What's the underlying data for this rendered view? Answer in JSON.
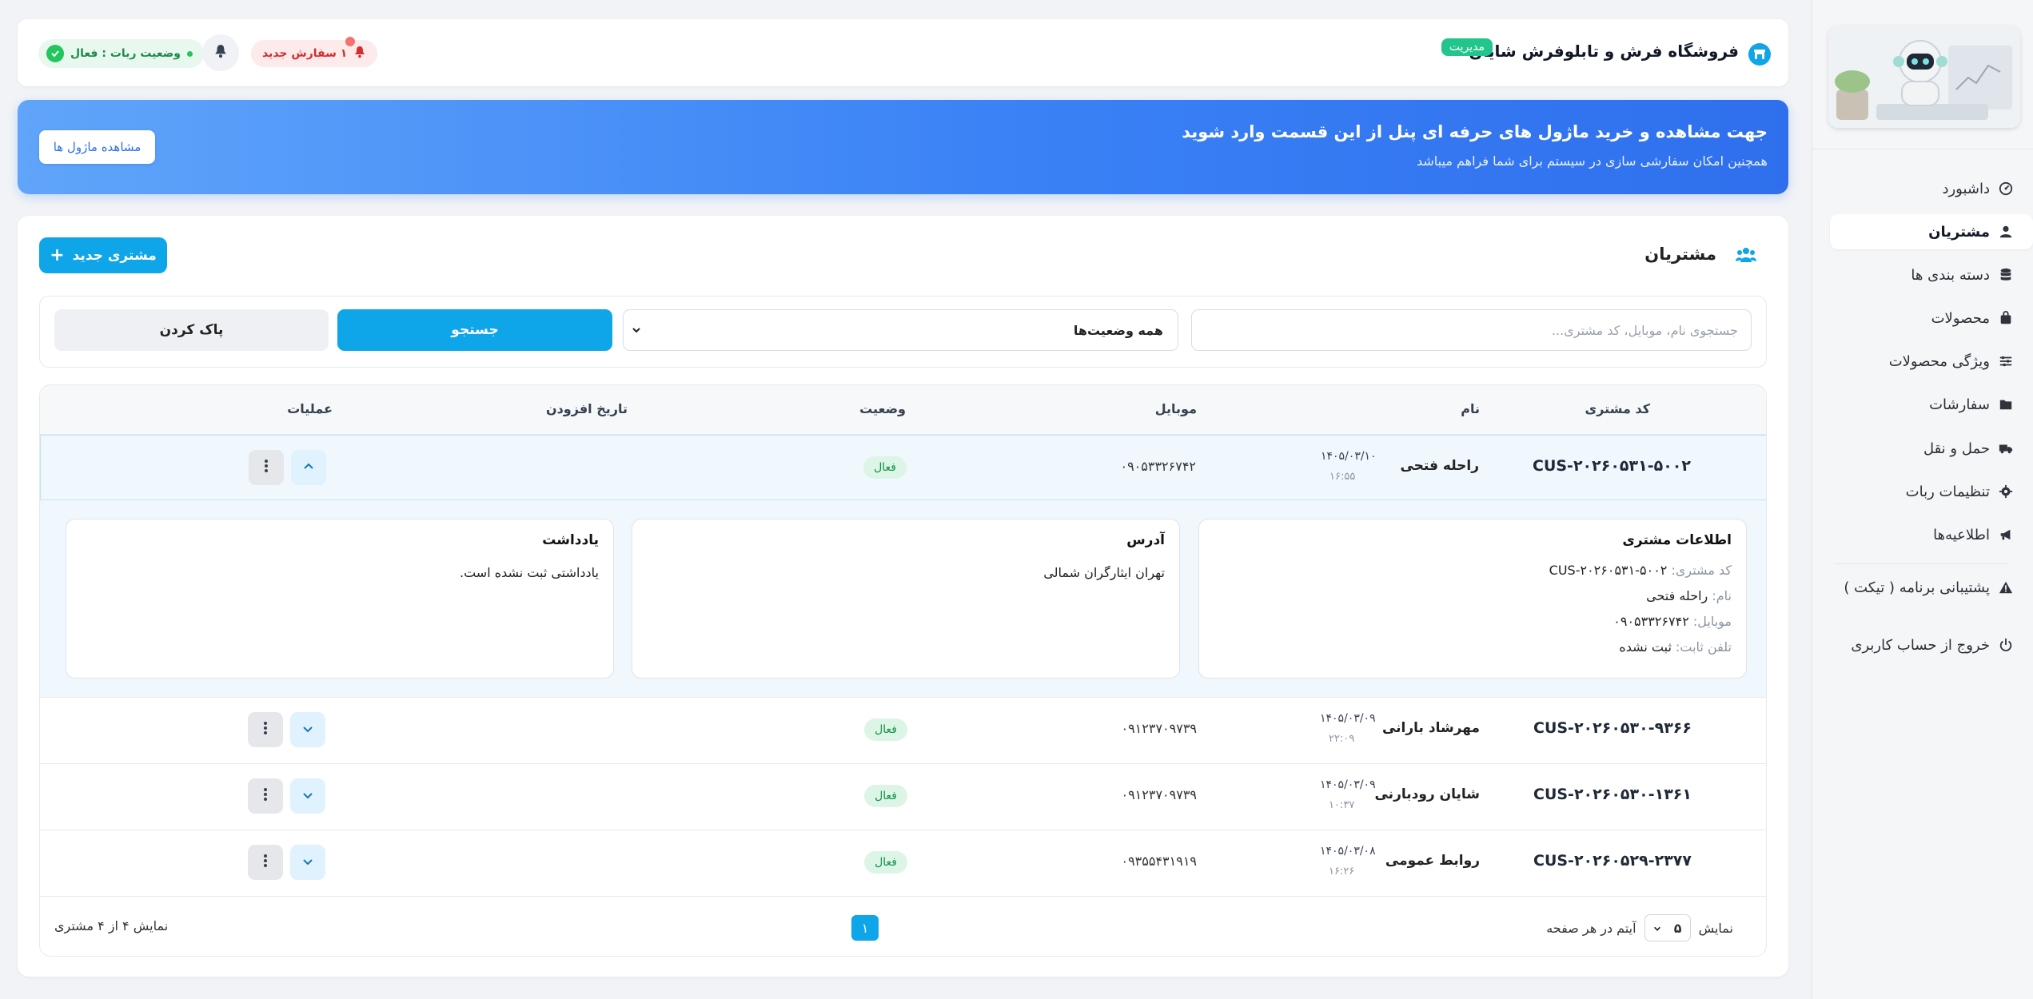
{
  "sidebar": {
    "items": [
      {
        "label": "داشبورد",
        "icon": "dashboard-icon",
        "active": false
      },
      {
        "label": "مشتریان",
        "icon": "user-icon",
        "active": true
      },
      {
        "label": "دسته بندی ها",
        "icon": "database-icon",
        "active": false
      },
      {
        "label": "محصولات",
        "icon": "bag-icon",
        "active": false
      },
      {
        "label": "ویژگی محصولات",
        "icon": "sliders-icon",
        "active": false
      },
      {
        "label": "سفارشات",
        "icon": "folder-icon",
        "active": false
      },
      {
        "label": "حمل و نقل",
        "icon": "truck-icon",
        "active": false
      },
      {
        "label": "تنظیمات ربات",
        "icon": "gear-icon",
        "active": false
      },
      {
        "label": "اطلاعیه‌ها",
        "icon": "megaphone-icon",
        "active": false
      }
    ],
    "support": {
      "label": "پشتیبانی برنامه ( تیکت )",
      "icon": "warning-icon"
    },
    "logout": {
      "label": "خروج از حساب کاربری",
      "icon": "power-icon"
    }
  },
  "header": {
    "store_name": "فروشگاه فرش و تابلوفرش شایان",
    "admin_badge": "مدیریت",
    "orders_chip": "۱ سفارش جدید",
    "bot_status": "وضعیت ربات : فعال"
  },
  "banner": {
    "title": "جهت مشاهده و خرید ماژول های حرفه ای پنل از این قسمت وارد شوید",
    "subtitle": "همچنین امکان سفارشی سازی در سیستم برای شما فراهم میباشد",
    "button": "مشاهده ماژول ها"
  },
  "customers": {
    "title": "مشتریان",
    "new_button": "مشتری جدید",
    "search_placeholder": "جستجوی نام، موبایل، کد مشتری...",
    "status_select": "همه وضعیت‌ها",
    "search_button": "جستجو",
    "clear_button": "پاک کردن",
    "columns": {
      "code": "کد مشتری",
      "name": "نام",
      "mobile": "موبایل",
      "status": "وضعیت",
      "date": "تاریخ افزودن",
      "actions": "عملیات"
    },
    "rows": [
      {
        "code": "CUS-۲۰۲۶۰۵۳۱-۵۰۰۲",
        "name": "راحله فتحی",
        "mobile": "۰۹۰۵۳۳۲۶۷۴۲",
        "status": "فعال",
        "date": "۱۴۰۵/۰۳/۱۰",
        "time": "۱۶:۵۵",
        "expanded": true
      },
      {
        "code": "CUS-۲۰۲۶۰۵۳۰-۹۳۶۶",
        "name": "مهرشاد بارانی",
        "mobile": "۰۹۱۲۳۷۰۹۷۳۹",
        "status": "فعال",
        "date": "۱۴۰۵/۰۳/۰۹",
        "time": "۲۲:۰۹",
        "expanded": false
      },
      {
        "code": "CUS-۲۰۲۶۰۵۳۰-۱۳۶۱",
        "name": "شایان رودبارنی",
        "mobile": "۰۹۱۲۳۷۰۹۷۳۹",
        "status": "فعال",
        "date": "۱۴۰۵/۰۳/۰۹",
        "time": "۱۰:۳۷",
        "expanded": false
      },
      {
        "code": "CUS-۲۰۲۶۰۵۲۹-۲۳۷۷",
        "name": "روابط عمومی",
        "mobile": "۰۹۳۵۵۴۳۱۹۱۹",
        "status": "فعال",
        "date": "۱۴۰۵/۰۳/۰۸",
        "time": "۱۶:۲۶",
        "expanded": false
      }
    ],
    "details": {
      "info_title": "اطلاعات مشتری",
      "code_label": "کد مشتری:",
      "code_value": "CUS-۲۰۲۶۰۵۳۱-۵۰۰۲",
      "name_label": "نام:",
      "name_value": "راحله فتحی",
      "mobile_label": "موبایل:",
      "mobile_value": "۰۹۰۵۳۳۲۶۷۴۲",
      "phone_label": "تلفن ثابت:",
      "phone_value": "ثبت نشده",
      "address_title": "آدرس",
      "address_value": "تهران ایثارگران شمالی",
      "note_title": "یادداشت",
      "note_value": "یادداشتی ثبت نشده است."
    },
    "pagination": {
      "show_label": "نمایش",
      "per_page_value": "۵",
      "per_page_label": "آیتم در هر صفحه",
      "current_page": "۱",
      "summary": "نمایش ۴ از ۴ مشتری"
    }
  },
  "colors": {
    "accent": "#0ea5e9",
    "banner_start": "#60a5fa",
    "banner_end": "#2f6fed",
    "success": "#22c55e",
    "danger": "#d62d2d"
  }
}
